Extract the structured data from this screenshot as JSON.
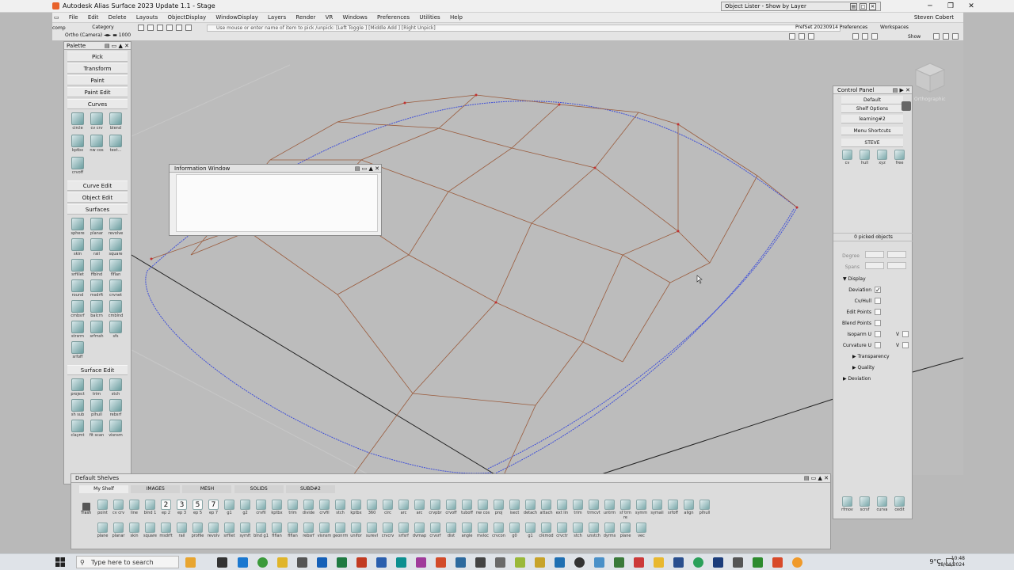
{
  "window": {
    "title": "Autodesk Alias Surface 2023 Update 1.1 - Stage",
    "object_lister": "Object Lister - Show by Layer",
    "user": "Steven Cobert"
  },
  "menu": [
    "File",
    "Edit",
    "Delete",
    "Layouts",
    "ObjectDisplay",
    "WindowDisplay",
    "Layers",
    "Render",
    "VR",
    "Windows",
    "Preferences",
    "Utilities",
    "Help"
  ],
  "toolbar": {
    "comp": "comp",
    "category": "Category",
    "ortho": "Ortho (Camera) ◄► ▬ 1000",
    "prompt": "Use mouse or enter name of item to pick /unpick: [Left Toggle ] [Middle Add ] [Right Unpick]",
    "prefset": "PrefSet 20230914 Preferences",
    "workspaces": "Workspaces",
    "show": "Show"
  },
  "palette": {
    "title": "Palette",
    "tabs_top": [
      "Pick",
      "Transform",
      "Paint",
      "Paint Edit"
    ],
    "curves_label": "Curves",
    "curves_tools": [
      "circle",
      "cv crv",
      "blend",
      "kptbx",
      "nw cos",
      "text...",
      "crvoff"
    ],
    "curve_edit": "Curve Edit",
    "object_edit": "Object Edit",
    "surfaces_label": "Surfaces",
    "surfaces_tools": [
      "sphere",
      "planar",
      "revolve",
      "skin",
      "rail",
      "square",
      "srfillet",
      "ffblnd",
      "flflan",
      "round",
      "msdrft",
      "crvnet",
      "cmbsrf",
      "balcrn",
      "cmblnd",
      "strsrm",
      "srfmsh",
      "sfs",
      "srfoff"
    ],
    "surface_edit": "Surface Edit",
    "surface_edit_tools": [
      "project",
      "trim",
      "stch",
      "sh sub",
      "plhull",
      "rebsrf",
      "claymt",
      "fit scan",
      "visnsm"
    ]
  },
  "info_window": {
    "title": "Information Window"
  },
  "viewcube_label": "Orthographic",
  "control_panel": {
    "title": "Control Panel",
    "preset": "Default",
    "shelf_options": "Shelf Options",
    "learning": "learning#2",
    "menu_shortcuts": "Menu Shortcuts",
    "steve": "STEVE",
    "steve_tools": [
      "cv",
      "hull",
      "xyz",
      "free"
    ],
    "picked": "0 picked objects",
    "degree": "Degree",
    "spans": "Spans",
    "display_section": "Display",
    "options": [
      {
        "label": "Deviation",
        "checked": "✓"
      },
      {
        "label": "Cv/Hull",
        "checked": ""
      },
      {
        "label": "Edit Points",
        "checked": ""
      },
      {
        "label": "Blend Points",
        "checked": ""
      }
    ],
    "isoparm": "Isoparm U",
    "curvature": "Curvature U",
    "v": "V",
    "transparency": "Transparency",
    "quality": "Quality",
    "deviation_section": "Deviation",
    "bottom_tools": [
      "rfmov",
      "scrsf",
      "curva",
      "cedit"
    ]
  },
  "shelves": {
    "title": "Default Shelves",
    "tabs": [
      "My Shelf",
      "IMAGES",
      "MESH",
      "SOLIDS",
      "SUBD#2"
    ],
    "row1": [
      "point",
      "cv crv",
      "line",
      "blnd 1",
      "ep 2",
      "ep 3",
      "ep 5",
      "ep 7",
      "g1",
      "g2",
      "crvfil",
      "kptbx",
      "trim",
      "divide",
      "crvfil",
      "stch",
      "kptbx",
      "360",
      "circ",
      "arc",
      "arc",
      "crvpbr",
      "crvoff",
      "tuboff",
      "nw cos",
      "proj",
      "isect",
      "detach",
      "attach",
      "ext lin",
      "trim",
      "trmcvt",
      "untrm",
      "sf trm re",
      "symm",
      "symali",
      "srfoff",
      "align",
      "plhull"
    ],
    "row1_glyphs": [
      "2",
      "3",
      "5",
      "7"
    ],
    "row2": [
      "plane",
      "planar",
      "skin",
      "square",
      "msdrft",
      "rail",
      "profile",
      "revolv",
      "srfllet",
      "symft",
      "blnd g1",
      "flflan",
      "flflan",
      "rebsrf",
      "visnsm",
      "geonrm",
      "unifor",
      "surevl",
      "crvcrv",
      "srfsrf",
      "dvmap",
      "crvsrf",
      "dist",
      "angle",
      "mvloc",
      "crvcon",
      "g0",
      "g1",
      "clkmod",
      "crvctr",
      "stch",
      "unstch",
      "dyrms",
      "plane",
      "vec"
    ],
    "trash": "Trash"
  },
  "taskbar": {
    "search": "Type here to search",
    "temp": "9°C",
    "time": "10:48",
    "date": "18/04/2024"
  }
}
